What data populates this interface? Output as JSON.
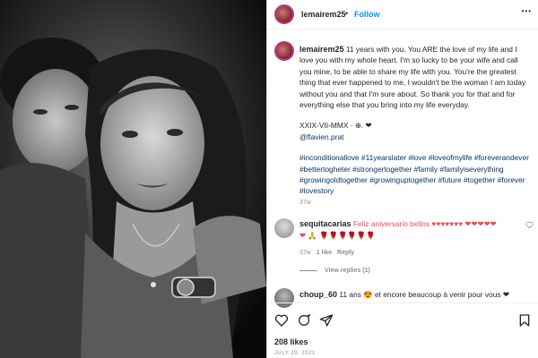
{
  "post": {
    "username": "lemairem25",
    "follow_label": "Follow",
    "separator": "•",
    "more_label": "•••"
  },
  "caption": {
    "username": "lemairem25",
    "text": "11 years with you. You ARE the love of my life and I love you with my whole heart. I'm so lucky to be your wife and call you mine, to be able to share my life with you. You're the greatest thing that ever happened to me, I wouldn't be the woman I am today without you and that I'm sure about. So thank you for that and for everything else that you bring into my life everyday.",
    "date_line": "XXIX-VII-MMX · ⊕. ❤",
    "mention": "@flavien.prat",
    "hashtags": "#inconditionallove #11yearslater #love #loveofmylife #foreverandever #bettertogheter #strongertogether #family #familyiseverything #growingoldtogether #growinguptogether #future #together #forever #lovestory",
    "age": "37w"
  },
  "comments": [
    {
      "username": "sequitacarias",
      "text": "Feliz aniversario bellos ♥♥♥♥♥♥♥ ❤❤❤❤❤",
      "text2": "❤ 🙏 🌹🌹🌹🌹🌹🌹",
      "age": "37w",
      "likes": "1 like",
      "reply": "Reply",
      "view_replies": "View replies (1)"
    },
    {
      "username": "choup_60",
      "text": "11 ans 😍 et encore beaucoup à venir pour vous ❤"
    }
  ],
  "stats": {
    "likes": "208 likes",
    "date": "JULY 29, 2021"
  },
  "icons": {
    "heart": "heart-icon",
    "comment": "comment-icon",
    "share": "share-icon",
    "save": "bookmark-icon"
  }
}
